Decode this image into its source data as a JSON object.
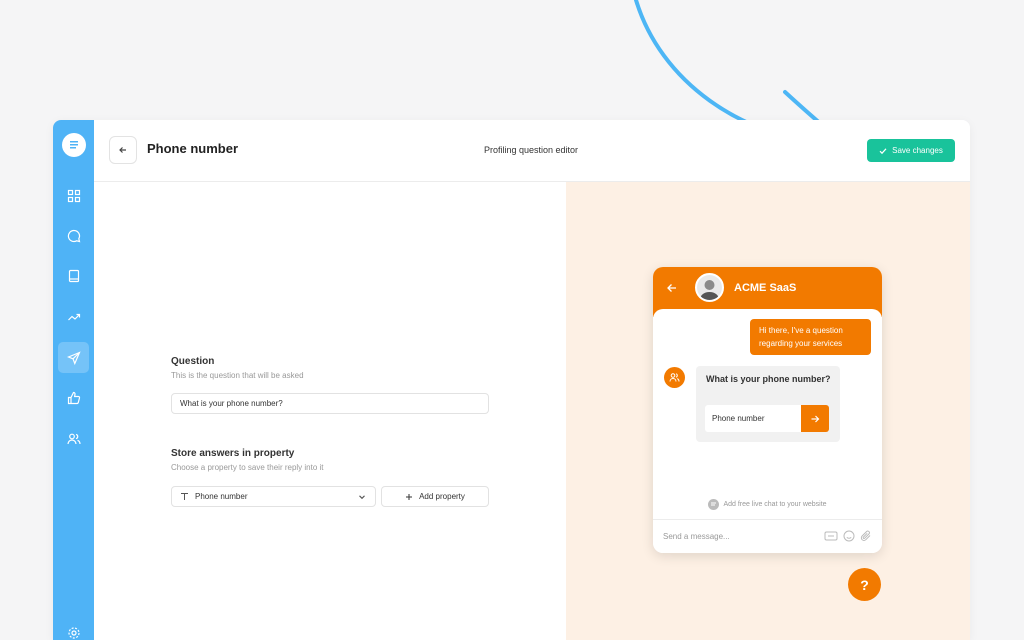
{
  "header": {
    "page_title": "Phone number",
    "center_title": "Profiling question editor",
    "save_label": "Save changes"
  },
  "form": {
    "question_label": "Question",
    "question_hint": "This is the question that will be asked",
    "question_value": "What is your phone number?",
    "store_label": "Store answers in property",
    "store_hint": "Choose a property to save their reply into it",
    "property_selected": "Phone number",
    "add_property_label": "Add property"
  },
  "chat": {
    "company_name": "ACME SaaS",
    "user_message": "Hi there, I've a question regarding your services",
    "question_text": "What is your phone number?",
    "answer_placeholder": "Phone number",
    "powered_by": "Add free live chat to your website",
    "message_placeholder": "Send a message..."
  },
  "help_label": "?",
  "colors": {
    "sidebar": "#4fb3f6",
    "accent_orange": "#f27a00",
    "save_green": "#19c39b",
    "preview_bg": "#fdf0e4",
    "arrow_blue": "#4db6f5"
  },
  "icons": {
    "sidebar": [
      "chat-logo-icon",
      "grid-icon",
      "chat-bubble-icon",
      "book-icon",
      "trend-icon",
      "send-icon",
      "thumbs-up-icon",
      "users-icon",
      "gear-icon"
    ]
  }
}
